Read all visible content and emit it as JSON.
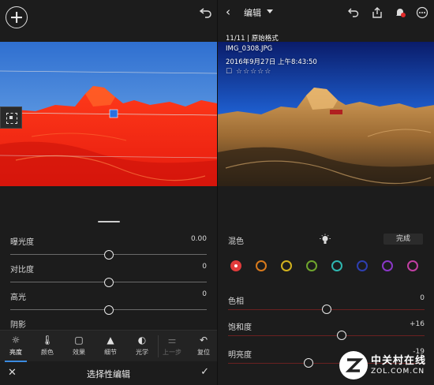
{
  "left_panel": {
    "sliders": [
      {
        "label": "曝光度",
        "value": "0.00",
        "position": 0.5
      },
      {
        "label": "对比度",
        "value": "0",
        "position": 0.5
      },
      {
        "label": "高光",
        "value": "0",
        "position": 0.5
      },
      {
        "label": "阴影",
        "value": "",
        "position": 0.5
      }
    ],
    "tools": [
      {
        "label": "亮度",
        "icon": "sun-icon",
        "glyph": "☼"
      },
      {
        "label": "颜色",
        "icon": "thermometer-icon",
        "glyph": "🌡"
      },
      {
        "label": "效果",
        "icon": "vignette-icon",
        "glyph": "▢"
      },
      {
        "label": "细节",
        "icon": "triangle-icon",
        "glyph": "▲"
      },
      {
        "label": "光学",
        "icon": "lens-icon",
        "glyph": "◐"
      },
      {
        "label": "上一步",
        "icon": "previous-icon",
        "glyph": "⚌"
      },
      {
        "label": "复位",
        "icon": "reset-icon",
        "glyph": "↶"
      }
    ],
    "bottom": {
      "close": "✕",
      "title": "选择性编辑",
      "confirm": "✓"
    }
  },
  "right_panel": {
    "header": {
      "back": "‹",
      "title": "编辑"
    },
    "photo_meta": {
      "index_and_type": "11/11 | 原始格式",
      "filename": "IMG_0308.JPG",
      "datetime": "2016年9月27日 上午8:43:50",
      "rating": "☐ ☆☆☆☆☆"
    },
    "mix": {
      "label": "混色",
      "done": "完成"
    },
    "color_swatches": [
      "#e23b3b",
      "#d87a1c",
      "#d2b21e",
      "#6fa52d",
      "#2fb7b0",
      "#2e3fb0",
      "#8a37c7",
      "#c23fa3"
    ],
    "hsl_sliders": [
      {
        "label": "色相",
        "value": "0",
        "position": 0.5
      },
      {
        "label": "饱和度",
        "value": "+16",
        "position": 0.58
      },
      {
        "label": "明亮度",
        "value": "-19",
        "position": 0.41
      }
    ]
  },
  "watermark": {
    "brand": "中关村在线",
    "site": "ZOL.COM.CN"
  }
}
